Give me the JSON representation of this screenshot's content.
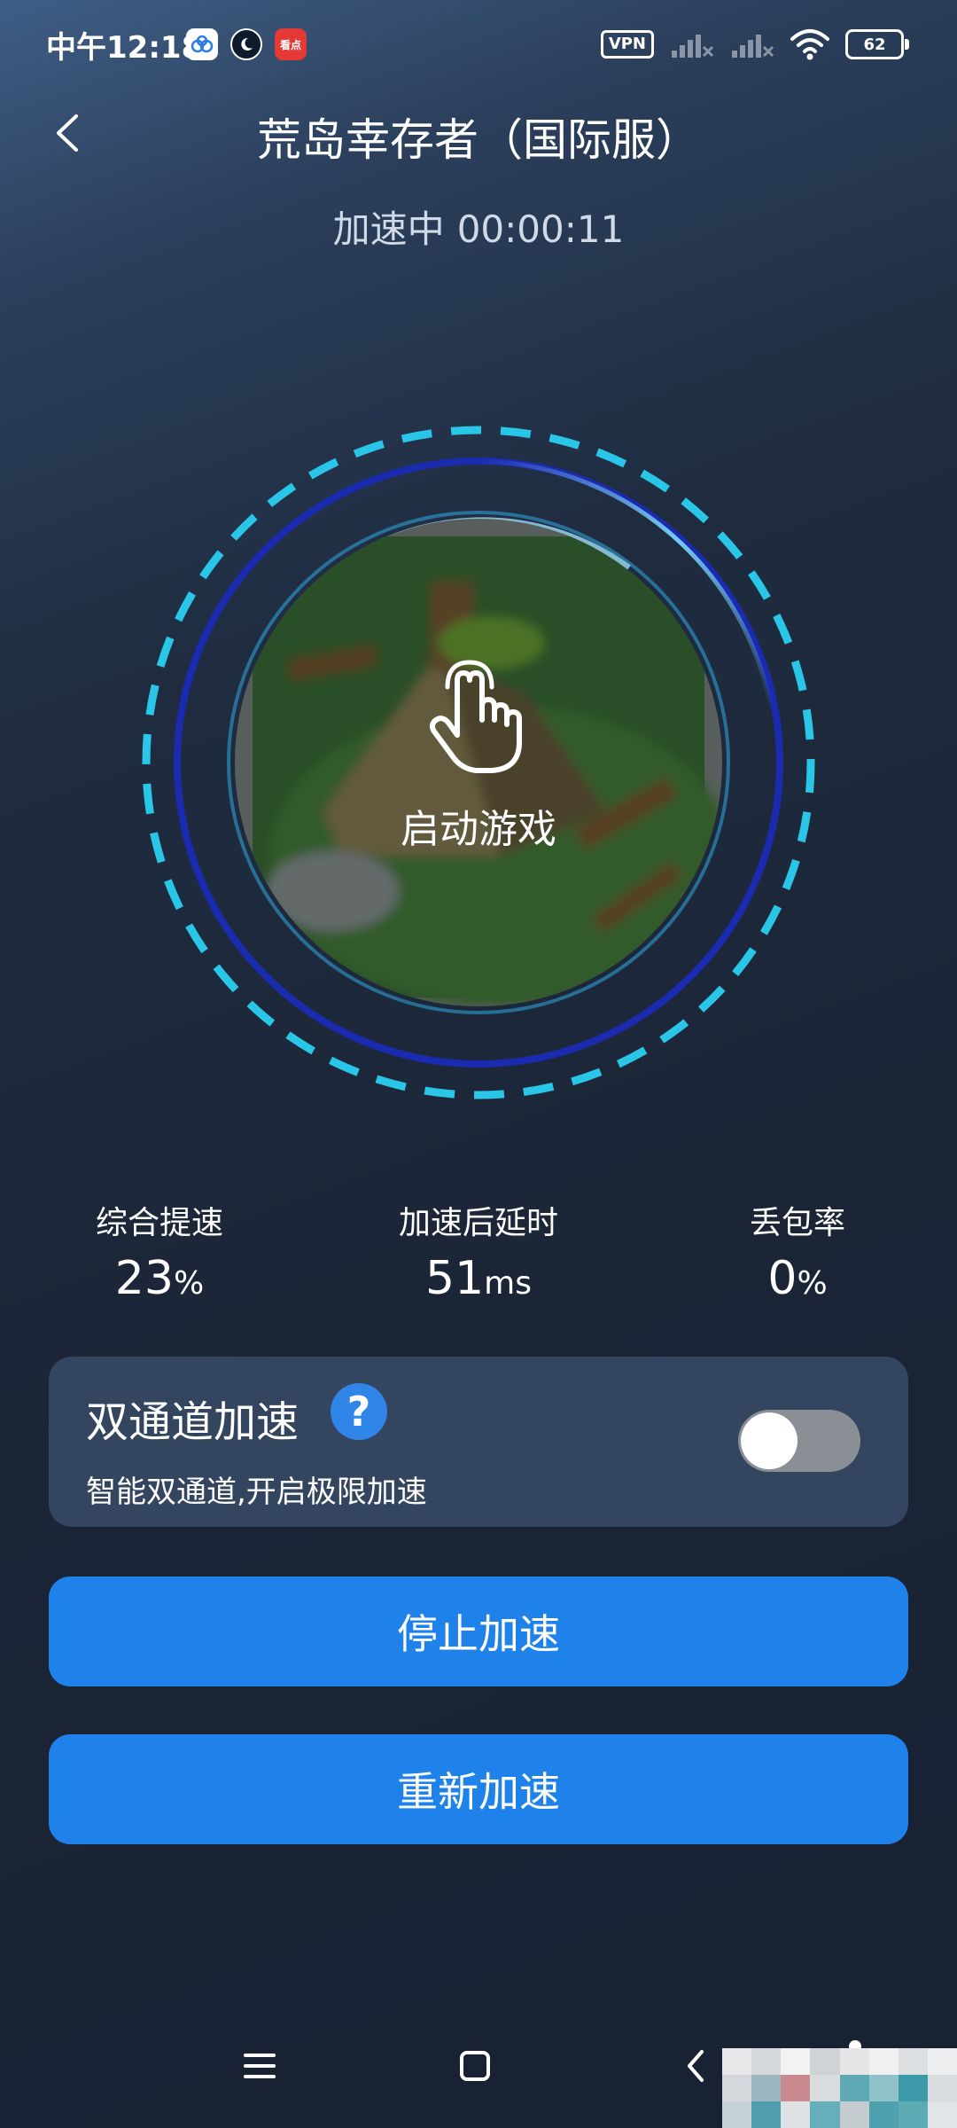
{
  "status_bar": {
    "time": "中午12:18",
    "vpn": "VPN",
    "battery": "62",
    "app_icon_labels": [
      "",
      "",
      "看点"
    ]
  },
  "header": {
    "title": "荒岛幸存者（国际服）",
    "status_text": "加速中",
    "timer": "00:00:11"
  },
  "launch": {
    "label": "启动游戏"
  },
  "stats": [
    {
      "label": "综合提速",
      "value": "23",
      "unit": "%"
    },
    {
      "label": "加速后延时",
      "value": "51",
      "unit": "ms"
    },
    {
      "label": "丢包率",
      "value": "0",
      "unit": "%"
    }
  ],
  "dual_channel": {
    "title": "双通道加速",
    "help": "?",
    "description": "智能双通道,开启极限加速",
    "enabled": false
  },
  "buttons": {
    "stop": "停止加速",
    "restart": "重新加速"
  },
  "colors": {
    "accent_cyan": "#29c6e8",
    "ring_dark_blue": "#1a2bb0",
    "button_blue": "#1f82ea",
    "card_bg": "#33455f",
    "help_blue": "#2f86e8"
  }
}
